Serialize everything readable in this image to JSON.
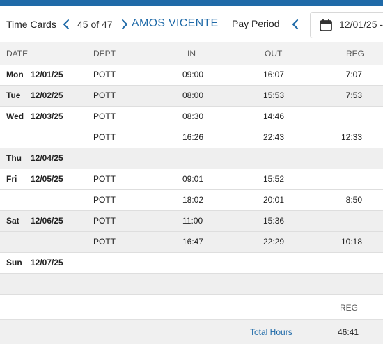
{
  "header": {
    "title": "Time Cards",
    "counter": "45 of 47",
    "employee_name": "AMOS VICENTE",
    "pay_period_label": "Pay Period",
    "date_value": "12/01/25 -"
  },
  "columns": {
    "date": "DATE",
    "dept": "DEPT",
    "in": "IN",
    "out": "OUT",
    "reg": "REG"
  },
  "rows": [
    {
      "day": "Mon",
      "date": "12/01/25",
      "dept": "POTT",
      "in": "09:00",
      "out": "16:07",
      "reg": "7:07"
    },
    {
      "day": "Tue",
      "date": "12/02/25",
      "dept": "POTT",
      "in": "08:00",
      "out": "15:53",
      "reg": "7:53"
    },
    {
      "day": "Wed",
      "date": "12/03/25",
      "dept": "POTT",
      "in": "08:30",
      "out": "14:46",
      "reg": ""
    },
    {
      "day": "",
      "date": "",
      "dept": "POTT",
      "in": "16:26",
      "out": "22:43",
      "reg": "12:33"
    },
    {
      "day": "Thu",
      "date": "12/04/25",
      "dept": "",
      "in": "",
      "out": "",
      "reg": ""
    },
    {
      "day": "Fri",
      "date": "12/05/25",
      "dept": "POTT",
      "in": "09:01",
      "out": "15:52",
      "reg": ""
    },
    {
      "day": "",
      "date": "",
      "dept": "POTT",
      "in": "18:02",
      "out": "20:01",
      "reg": "8:50"
    },
    {
      "day": "Sat",
      "date": "12/06/25",
      "dept": "POTT",
      "in": "11:00",
      "out": "15:36",
      "reg": ""
    },
    {
      "day": "",
      "date": "",
      "dept": "POTT",
      "in": "16:47",
      "out": "22:29",
      "reg": "10:18"
    },
    {
      "day": "Sun",
      "date": "12/07/25",
      "dept": "",
      "in": "",
      "out": "",
      "reg": ""
    },
    {
      "day": "",
      "date": "",
      "dept": "",
      "in": "",
      "out": "",
      "reg": ""
    }
  ],
  "summary": {
    "reg_label": "REG",
    "total_label": "Total Hours",
    "total_value": "46:41"
  },
  "colors": {
    "accent": "#1f6aa8",
    "row_shade": "#efefef"
  },
  "icons": {
    "prev": "chevron-left-icon",
    "next": "chevron-right-icon",
    "calendar": "calendar-icon"
  }
}
